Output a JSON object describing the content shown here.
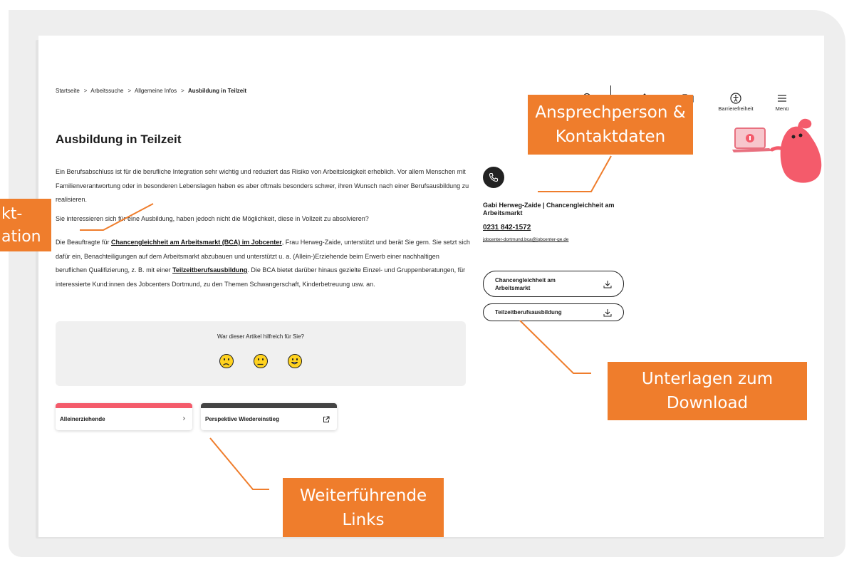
{
  "breadcrumb": {
    "items": [
      "Startseite",
      "Arbeitssuche",
      "Allgemeine Infos"
    ],
    "current": "Ausbildung in Teilzeit"
  },
  "nav": {
    "accessibility": "Barrierefreiheit",
    "menu": "Menü"
  },
  "article": {
    "title": "Ausbildung in Teilzeit",
    "intro": "Ein Berufsabschluss ist für die berufliche Integration sehr wichtig und reduziert das Risiko von Arbeitslosigkeit erheblich. Vor allem Menschen mit Familienverantwortung oder in besonderen Lebenslagen haben es aber oftmals besonders schwer, ihren Wunsch nach einer Berufsausbildung zu realisieren.",
    "question": "Sie interessieren sich für eine Ausbildung, haben jedoch nicht die Möglichkeit, diese in Vollzeit zu absolvieren?",
    "p3_a": "Die Beauftragte für ",
    "p3_link1": "Chancengleichheit am Arbeitsmarkt (BCA) im Jobcenter",
    "p3_b": ", Frau Herweg-Zaide, unterstützt und berät Sie gern. Sie setzt sich dafür ein, Benachteiligungen auf dem Arbeitsmarkt abzubauen und unterstützt u. a. (Allein-)Erziehende beim Erwerb einer nachhaltigen beruflichen Qualifizierung, z. B. mit einer ",
    "p3_link2": "Teilzeitberufsausbildung",
    "p3_c": ". Die BCA bietet darüber hinaus gezielte Einzel- und Gruppenberatungen, für interessierte Kund:innen des Jobcenters Dortmund, zu den Themen Schwangerschaft, Kinderbetreuung usw. an."
  },
  "feedback": {
    "question": "War dieser Artikel hilfreich für Sie?"
  },
  "links": [
    {
      "label": "Alleinerziehende",
      "icon": "chevron-right-icon",
      "color": "#f45b6b"
    },
    {
      "label": "Perspektive Wiedereinstieg",
      "icon": "external-link-icon",
      "color": "#444444"
    }
  ],
  "contact": {
    "name": "Gabi Herweg-Zaide | Chancengleichheit am Arbeitsmarkt",
    "phone": "0231 842-1572",
    "email": "jobcenter-dortmund.bca@jobcenter-ge.de"
  },
  "downloads": [
    {
      "label": "Chancengleichheit am Arbeitsmarkt"
    },
    {
      "label": "Teilzeitberufsausbildung"
    }
  ],
  "callouts": {
    "contact": [
      "Ansprechperson &",
      "Kontaktdaten"
    ],
    "downloads": [
      "Unterlagen zum",
      "Download"
    ],
    "links": [
      "Weiterführende",
      "Links"
    ],
    "text": [
      "kt-",
      "ation"
    ]
  },
  "colors": {
    "callout": "#ef7d2c",
    "link_card_1": "#f45b6b",
    "link_card_2": "#444444",
    "emoji": "#ffd21f"
  }
}
